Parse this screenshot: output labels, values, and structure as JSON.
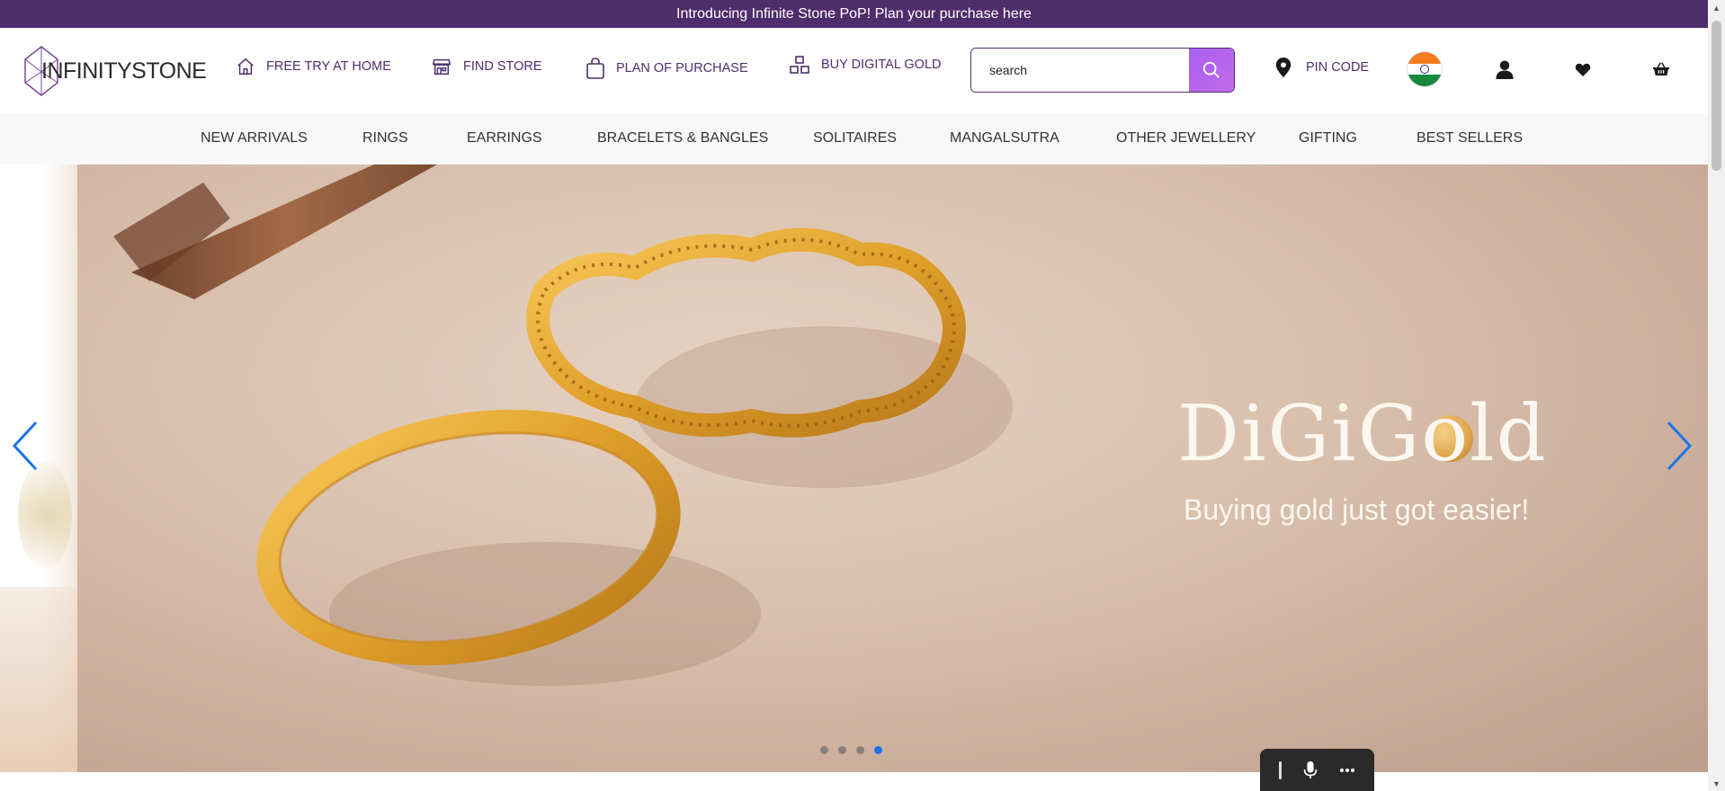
{
  "announcement": {
    "text": "Introducing Infinite Stone PoP! Plan your purchase here"
  },
  "header": {
    "logo_text": "INFINITYSTONE",
    "nav": [
      {
        "label": "FREE TRY AT HOME",
        "icon": "home-icon"
      },
      {
        "label": "FIND STORE",
        "icon": "store-icon"
      },
      {
        "label": "PLAN OF PURCHASE",
        "icon": "shopping-bag-icon"
      },
      {
        "label": "BUY DIGITAL GOLD",
        "icon": "gold-bars-icon"
      }
    ],
    "search": {
      "placeholder": "search",
      "value": "search"
    },
    "pin_code_label": "PIN CODE",
    "country_flag": "india-flag",
    "icons": [
      "user-icon",
      "heart-icon",
      "basket-icon"
    ]
  },
  "categories": [
    "NEW ARRIVALS",
    "RINGS",
    "EARRINGS",
    "BRACELETS & BANGLES",
    "SOLITAIRES",
    "MANGALSUTRA",
    "OTHER JEWELLERY",
    "GIFTING",
    "BEST SELLERS"
  ],
  "hero": {
    "title": "DiGiGold",
    "subtitle": "Buying gold just got easier!",
    "slide_count": 4,
    "active_slide": 4
  },
  "floating_toolbar": {
    "icons": [
      "grip-icon",
      "microphone-icon",
      "more-icon"
    ]
  },
  "colors": {
    "brand_purple": "#4f2d6b",
    "search_button": "#b466ee",
    "carousel_arrow": "#1b74e8",
    "active_dot": "#1b74e8"
  }
}
